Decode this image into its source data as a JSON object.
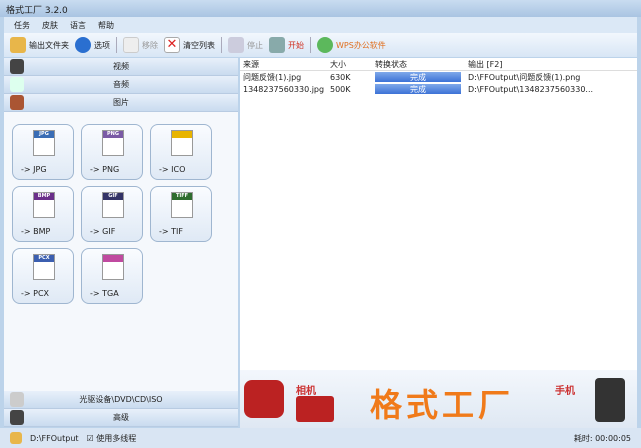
{
  "title": "格式工厂 3.2.0",
  "menu": [
    "任务",
    "皮肤",
    "语言",
    "帮助"
  ],
  "toolbar": {
    "output_folder": "输出文件夹",
    "options": "选项",
    "remove": "移除",
    "clear": "清空列表",
    "stop": "停止",
    "start": "开始",
    "wps": "WPS办公软件"
  },
  "categories": {
    "video": "视频",
    "audio": "音频",
    "picture": "图片",
    "rom": "光驱设备\\DVD\\CD\\ISO",
    "advanced": "高级"
  },
  "tiles": [
    {
      "badge": "JPG",
      "label": "-> JPG",
      "color": "#3a6db5"
    },
    {
      "badge": "PNG",
      "label": "-> PNG",
      "color": "#7a5aa5"
    },
    {
      "badge": "",
      "label": "-> ICO",
      "color": "#e8b400"
    },
    {
      "badge": "BMP",
      "label": "-> BMP",
      "color": "#6a2f8a"
    },
    {
      "badge": "GIF",
      "label": "-> GIF",
      "color": "#333366"
    },
    {
      "badge": "TIFF",
      "label": "-> TIF",
      "color": "#2f6d2f"
    },
    {
      "badge": "PCX",
      "label": "-> PCX",
      "color": "#3c5fb0"
    },
    {
      "badge": "",
      "label": "-> TGA",
      "color": "#c04aa0"
    }
  ],
  "list": {
    "headers": [
      "来源",
      "大小",
      "转换状态",
      "输出 [F2]"
    ],
    "rows": [
      {
        "source": "问题反馈(1).jpg",
        "size": "630K",
        "status": "完成",
        "output": "D:\\FFOutput\\问题反馈(1).png"
      },
      {
        "source": "1348237560330.jpg",
        "size": "500K",
        "status": "完成",
        "output": "D:\\FFOutput\\1348237560330..."
      }
    ]
  },
  "banner": {
    "logo": "格式工厂",
    "camera": "相机",
    "phone": "手机"
  },
  "status": {
    "folder": "D:\\FFOutput",
    "multithread": "使用多线程",
    "time": "耗时: 00:00:05"
  }
}
